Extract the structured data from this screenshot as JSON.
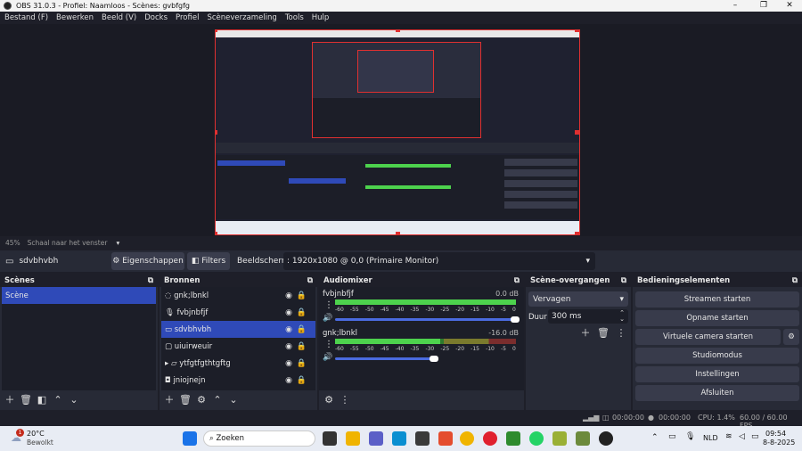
{
  "window": {
    "title": "OBS 31.0.3 - Profiel: Naamloos - Scènes: gvbfgfg"
  },
  "menu": [
    "Bestand (F)",
    "Bewerken",
    "Beeld (V)",
    "Docks",
    "Profiel",
    "Scèneverzameling",
    "Tools",
    "Hulp"
  ],
  "preview": {
    "zoom": "45%",
    "scale_label": "Schaal naar het venster"
  },
  "source_bar": {
    "source_name": "sdvbhvbh",
    "properties": "Eigenschappen",
    "filters": "Filters",
    "display_label": "Beeldscherm",
    "display_value": ": 1920x1080 @ 0,0 (Primaire Monitor)"
  },
  "scenes": {
    "title": "Scènes",
    "items": [
      "Scène"
    ]
  },
  "sources": {
    "title": "Bronnen",
    "items": [
      {
        "name": "gnk;lbnkl",
        "icon": "audio-input-icon"
      },
      {
        "name": "fvbjnbfjf",
        "icon": "microphone-icon"
      },
      {
        "name": "sdvbhvbh",
        "icon": "monitor-icon",
        "selected": true
      },
      {
        "name": "uiuirweuir",
        "icon": "window-icon"
      },
      {
        "name": "ytfgtfgthtgftg",
        "icon": "folder-icon"
      },
      {
        "name": "jniojnejn",
        "icon": "camera-icon"
      }
    ]
  },
  "audio": {
    "title": "Audiomixer",
    "scale": [
      "-60",
      "-55",
      "-50",
      "-45",
      "-40",
      "-35",
      "-30",
      "-25",
      "-20",
      "-15",
      "-10",
      "-5",
      "0"
    ],
    "channels": [
      {
        "name": "fvbjnbfjf",
        "db": "0.0 dB",
        "level": 1.0,
        "volume": 1.0
      },
      {
        "name": "gnk;lbnkl",
        "db": "-16.0 dB",
        "level": 0.58,
        "volume": 0.55
      }
    ]
  },
  "transitions": {
    "title": "Scène-overgangen",
    "type": "Vervagen",
    "duration_label": "Duur",
    "duration": "300 ms"
  },
  "controls": {
    "title": "Bedieningselementen",
    "stream": "Streamen starten",
    "record": "Opname starten",
    "virtualcam": "Virtuele camera starten",
    "studio": "Studiomodus",
    "settings": "Instellingen",
    "exit": "Afsluiten"
  },
  "status": {
    "time1": "00:00:00",
    "time2": "00:00:00",
    "cpu": "CPU: 1.4%",
    "fps": "60.00 / 60.00 FPS"
  },
  "taskbar": {
    "weather_temp": "20°C",
    "weather_desc": "Bewolkt",
    "weather_badge": "1",
    "search": "Zoeken",
    "lang": "NLD",
    "time": "09:54",
    "date": "8-8-2025"
  },
  "colors": {
    "accent": "#2f4ab8",
    "selection": "#e03030"
  }
}
